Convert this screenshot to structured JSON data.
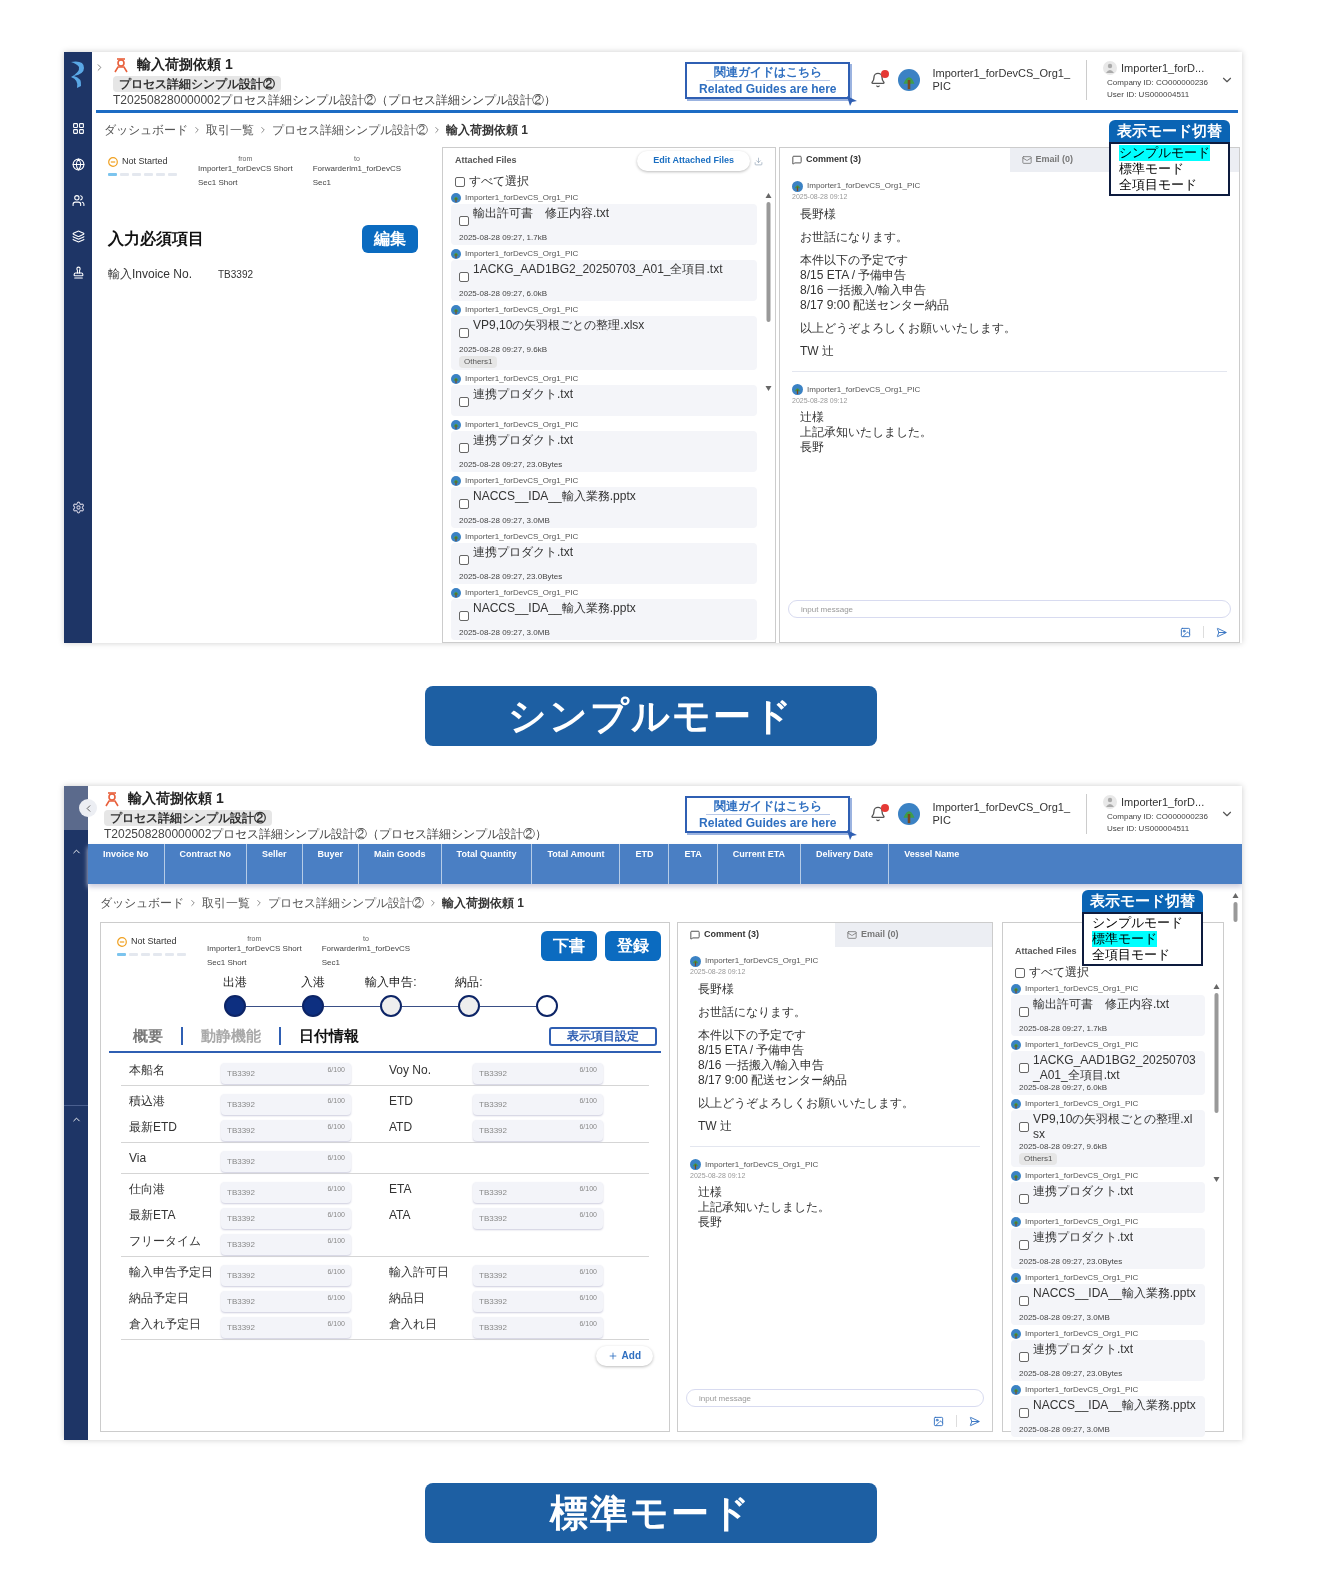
{
  "screens": [
    {
      "kind": "simple",
      "caption": "シンプルモード",
      "header": {
        "title": "輸入荷捌依頼 1",
        "process_chip": "プロセス詳細シンプル設計②",
        "transaction": "T202508280000002プロセス詳細シンプル設計②（プロセス詳細シンプル設計②）",
        "guide": [
          "関連ガイドはこちら",
          "Related Guides are here"
        ],
        "unread": true,
        "user": [
          "Importer1_forDevCS_Org1_",
          "PIC"
        ],
        "account": {
          "name": "Importer1_forD...",
          "company": "Company ID: CO000000236",
          "user_id": "User ID: US000004511"
        }
      },
      "breadcrumb": [
        "ダッシュボード",
        "取引一覧",
        "プロセス詳細シンプル設計②",
        "輸入荷捌依頼 1"
      ],
      "mode_menu": {
        "title": "表示モード切替",
        "options": [
          {
            "label": "シンプルモード",
            "selected": true
          },
          {
            "label": "標準モード",
            "selected": false
          },
          {
            "label": "全項目モード",
            "selected": false
          }
        ]
      },
      "status": {
        "label": "Not Started",
        "parties": [
          {
            "label": "from",
            "lines": [
              "Importer1_forDevCS Short",
              "Sec1 Short"
            ]
          },
          {
            "label": "to",
            "lines": [
              "Forwarderlm1_forDevCS",
              "Sec1"
            ]
          }
        ]
      },
      "required": {
        "title": "入力必須項目",
        "button": "編集",
        "fields": [
          {
            "label": "輸入Invoice No.",
            "value": "TB3392"
          }
        ]
      },
      "files": {
        "title": "Attached Files",
        "edit_button": "Edit Attached Files",
        "select_all": {
          "label": "すべて選択",
          "checked": false
        },
        "items": [
          {
            "author": "Importer1_forDevCS_Org1_PIC",
            "name": "輸出許可書　修正内容.txt",
            "meta": "2025-08-28 09:27, 1.7kB",
            "checked": false
          },
          {
            "author": "Importer1_forDevCS_Org1_PIC",
            "name": "1ACKG_AAD1BG2_20250703_A01_全項目.txt",
            "meta": "2025-08-28 09:27, 6.0kB",
            "checked": false
          },
          {
            "author": "Importer1_forDevCS_Org1_PIC",
            "name": "VP9,10の矢羽根ごとの整理.xlsx",
            "meta": "2025-08-28 09:27, 9.6kB",
            "tag": "Others1",
            "checked": false
          },
          {
            "author": "Importer1_forDevCS_Org1_PIC",
            "name": "連携プロダクト.txt",
            "checked": false
          },
          {
            "author": "Importer1_forDevCS_Org1_PIC",
            "name": "連携プロダクト.txt",
            "meta": "2025-08-28 09:27, 23.0Bytes",
            "checked": false
          },
          {
            "author": "Importer1_forDevCS_Org1_PIC",
            "name": "NACCS__IDA__輸入業務.pptx",
            "meta": "2025-08-28 09:27, 3.0MB",
            "checked": false
          },
          {
            "author": "Importer1_forDevCS_Org1_PIC",
            "name": "連携プロダクト.txt",
            "meta": "2025-08-28 09:27, 23.0Bytes",
            "checked": false
          },
          {
            "author": "Importer1_forDevCS_Org1_PIC",
            "name": "NACCS__IDA__輸入業務.pptx",
            "meta": "2025-08-28 09:27, 3.0MB",
            "checked": false
          }
        ]
      },
      "comments": {
        "tabs": [
          {
            "label": "Comment (3)",
            "selected": true
          },
          {
            "label": "Email (0)",
            "selected": false
          }
        ],
        "messages": [
          {
            "author": "Importer1_forDevCS_Org1_PIC",
            "time": "2025-08-28 09:12",
            "paragraphs": [
              [
                "長野様"
              ],
              [
                "お世話になります。"
              ],
              [
                "本件以下の予定です",
                "8/15 ETA / 予備申告",
                "8/16 一括搬入/輸入申告",
                "8/17 9:00 配送センター納品"
              ],
              [
                "以上どうぞよろしくお願いいたします。"
              ],
              [
                "TW 辻"
              ]
            ]
          },
          {
            "author": "Importer1_forDevCS_Org1_PIC",
            "time": "2025-08-28 09:12",
            "paragraphs": [
              [
                "辻様",
                "上記承知いたしました。",
                "長野"
              ]
            ]
          }
        ],
        "placeholder": "input message"
      }
    },
    {
      "kind": "standard",
      "caption": "標準モード",
      "header": {
        "title": "輸入荷捌依頼 1",
        "process_chip": "プロセス詳細シンプル設計②",
        "transaction": "T202508280000002プロセス詳細シンプル設計②（プロセス詳細シンプル設計②）",
        "guide": [
          "関連ガイドはこちら",
          "Related Guides are here"
        ],
        "unread": true,
        "user": [
          "Importer1_forDevCS_Org1_",
          "PIC"
        ],
        "account": {
          "name": "Importer1_forD...",
          "company": "Company ID: CO000000236",
          "user_id": "User ID: US000004511"
        }
      },
      "columns": [
        "Invoice No",
        "Contract No",
        "Seller",
        "Buyer",
        "Main Goods",
        "Total Quantity",
        "Total Amount",
        "ETD",
        "ETA",
        "Current ETA",
        "Delivery Date",
        "Vessel Name"
      ],
      "breadcrumb": [
        "ダッシュボード",
        "取引一覧",
        "プロセス詳細シンプル設計②",
        "輸入荷捌依頼 1"
      ],
      "mode_menu": {
        "title": "表示モード切替",
        "options": [
          {
            "label": "シンプルモード",
            "selected": false
          },
          {
            "label": "標準モード",
            "selected": true
          },
          {
            "label": "全項目モード",
            "selected": false
          }
        ]
      },
      "status": {
        "label": "Not Started",
        "parties": [
          {
            "label": "from",
            "lines": [
              "Importer1_forDevCS Short",
              "Sec1 Short"
            ]
          },
          {
            "label": "to",
            "lines": [
              "Forwarderlm1_forDevCS",
              "Sec1"
            ]
          }
        ]
      },
      "actions": [
        "下書",
        "登録"
      ],
      "steps": [
        {
          "label": "出港",
          "done": true
        },
        {
          "label": "入港",
          "done": true
        },
        {
          "label": "輸入申告:",
          "done": false
        },
        {
          "label": "納品:",
          "done": false
        },
        {
          "done": false
        }
      ],
      "tabs": [
        {
          "label": "概要",
          "selected": false,
          "disabled": false
        },
        {
          "label": "動静機能",
          "selected": false,
          "disabled": true
        },
        {
          "label": "日付情報",
          "selected": true,
          "disabled": false
        }
      ],
      "settings_button": "表示項目設定",
      "form": [
        [
          [
            {
              "label": "本船名",
              "placeholder": "TB3392",
              "counter": "6/100"
            },
            {
              "label": "Voy No.",
              "placeholder": "TB3392",
              "counter": "6/100"
            }
          ]
        ],
        [
          [
            {
              "label": "積込港",
              "placeholder": "TB3392",
              "counter": "6/100"
            },
            {
              "label": "ETD",
              "placeholder": "TB3392",
              "counter": "6/100"
            }
          ],
          [
            {
              "label": "最新ETD",
              "placeholder": "TB3392",
              "counter": "6/100"
            },
            {
              "label": "ATD",
              "placeholder": "TB3392",
              "counter": "6/100"
            }
          ]
        ],
        [
          [
            {
              "label": "Via",
              "placeholder": "TB3392",
              "counter": "6/100"
            }
          ]
        ],
        [
          [
            {
              "label": "仕向港",
              "placeholder": "TB3392",
              "counter": "6/100"
            },
            {
              "label": "ETA",
              "placeholder": "TB3392",
              "counter": "6/100"
            }
          ],
          [
            {
              "label": "最新ETA",
              "placeholder": "TB3392",
              "counter": "6/100"
            },
            {
              "label": "ATA",
              "placeholder": "TB3392",
              "counter": "6/100"
            }
          ],
          [
            {
              "label": "フリータイム",
              "placeholder": "TB3392",
              "counter": "6/100"
            }
          ]
        ],
        [
          [
            {
              "label": "輸入申告予定日",
              "placeholder": "TB3392",
              "counter": "6/100"
            },
            {
              "label": "輸入許可日",
              "placeholder": "TB3392",
              "counter": "6/100"
            }
          ],
          [
            {
              "label": "納品予定日",
              "placeholder": "TB3392",
              "counter": "6/100"
            },
            {
              "label": "納品日",
              "placeholder": "TB3392",
              "counter": "6/100"
            }
          ],
          [
            {
              "label": "倉入れ予定日",
              "placeholder": "TB3392",
              "counter": "6/100"
            },
            {
              "label": "倉入れ日",
              "placeholder": "TB3392",
              "counter": "6/100"
            }
          ]
        ]
      ],
      "add_button": "Add",
      "files": {
        "title": "Attached Files",
        "select_all": {
          "label": "すべて選択",
          "checked": false
        },
        "items": [
          {
            "author": "Importer1_forDevCS_Org1_PIC",
            "name": "輸出許可書　修正内容.txt",
            "meta": "2025-08-28 09:27, 1.7kB",
            "checked": false
          },
          {
            "author": "Importer1_forDevCS_Org1_PIC",
            "name": "1ACKG_AAD1BG2_20250703_A01_全項目.txt",
            "meta": "2025-08-28 09:27, 6.0kB",
            "checked": false
          },
          {
            "author": "Importer1_forDevCS_Org1_PIC",
            "name": "VP9,10の矢羽根ごとの整理.xlsx",
            "meta": "2025-08-28 09:27, 9.6kB",
            "tag": "Others1",
            "checked": false
          },
          {
            "author": "Importer1_forDevCS_Org1_PIC",
            "name": "連携プロダクト.txt",
            "checked": false
          },
          {
            "author": "Importer1_forDevCS_Org1_PIC",
            "name": "連携プロダクト.txt",
            "meta": "2025-08-28 09:27, 23.0Bytes",
            "checked": false
          },
          {
            "author": "Importer1_forDevCS_Org1_PIC",
            "name": "NACCS__IDA__輸入業務.pptx",
            "meta": "2025-08-28 09:27, 3.0MB",
            "checked": false
          },
          {
            "author": "Importer1_forDevCS_Org1_PIC",
            "name": "連携プロダクト.txt",
            "meta": "2025-08-28 09:27, 23.0Bytes",
            "checked": false
          },
          {
            "author": "Importer1_forDevCS_Org1_PIC",
            "name": "NACCS__IDA__輸入業務.pptx",
            "meta": "2025-08-28 09:27, 3.0MB",
            "checked": false
          }
        ]
      },
      "comments": {
        "tabs": [
          {
            "label": "Comment (3)",
            "selected": true
          },
          {
            "label": "Email (0)",
            "selected": false
          }
        ],
        "messages": [
          {
            "author": "Importer1_forDevCS_Org1_PIC",
            "time": "2025-08-28 09:12",
            "paragraphs": [
              [
                "長野様"
              ],
              [
                "お世話になります。"
              ],
              [
                "本件以下の予定です",
                "8/15 ETA / 予備申告",
                "8/16 一括搬入/輸入申告",
                "8/17 9:00 配送センター納品"
              ],
              [
                "以上どうぞよろしくお願いいたします。"
              ],
              [
                "TW 辻"
              ]
            ]
          },
          {
            "author": "Importer1_forDevCS_Org1_PIC",
            "time": "2025-08-28 09:12",
            "paragraphs": [
              [
                "辻様",
                "上記承知いたしました。",
                "長野"
              ]
            ]
          }
        ],
        "placeholder": "input message"
      }
    }
  ]
}
